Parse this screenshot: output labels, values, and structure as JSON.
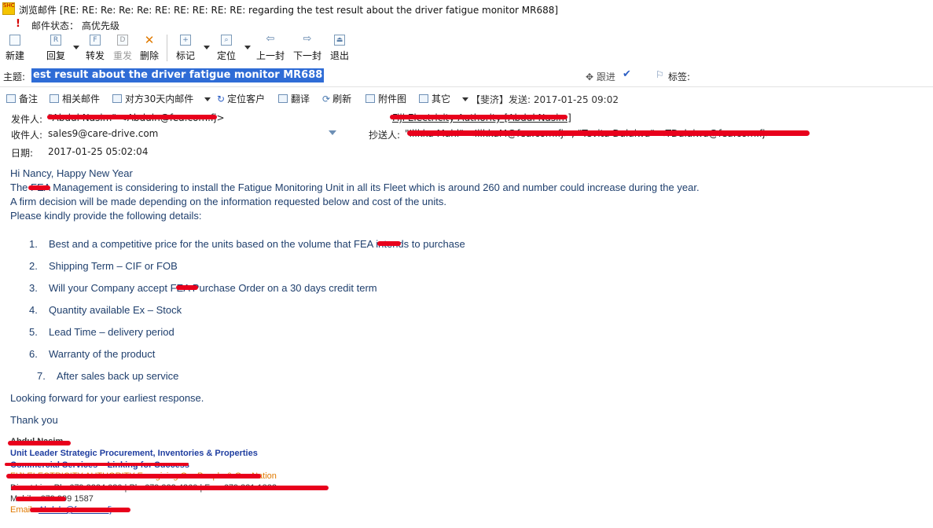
{
  "window": {
    "title": "浏览邮件 [RE: RE: Re: Re: Re: RE: RE: RE: RE: RE: regarding the test result about the driver fatigue monitor MR688]",
    "app_icon_text": "SHOP"
  },
  "mail_status": {
    "label": "邮件状态：",
    "value": "高优先级"
  },
  "toolbar": {
    "new_label": "新建",
    "reply_label": "回复",
    "forward_label": "转发",
    "resend_label": "重发",
    "delete_label": "删除",
    "mark_label": "标记",
    "locate_label": "定位",
    "prev_label": "上一封",
    "next_label": "下一封",
    "exit_label": "退出"
  },
  "subject": {
    "label": "主题:",
    "value": "est result about the driver fatigue monitor MR688",
    "follow_label": "跟进",
    "tag_label": "标签:"
  },
  "actions": {
    "note": "备注",
    "related_mail": "相关邮件",
    "counterpart_30days": "对方30天内邮件",
    "locate_customer": "定位客户",
    "translate": "翻译",
    "refresh": "刷新",
    "attachment_view": "附件图",
    "other": "其它",
    "meta": "【斐济】发送: 2017-01-25 09:02"
  },
  "headers": {
    "from_label": "发件人:",
    "from_value": "\"Abdul Nasim\" <Abduln@fea.com.fj>",
    "to_label": "收件人:",
    "to_value": "sales9@care-drive.com",
    "cc_label": "抄送人:",
    "cc_value": "\"Ilikka Mahl\" <IlikkaM@fea.com.fj>; \"Tevita Dalaiwa\" <TDalaiwa@fea.com.fj>",
    "date_label": "日期:",
    "date_value": "2017-01-25 05:02:04",
    "org_value": "Fiji Electricity Authority [Abdul Nasim]"
  },
  "body": {
    "greeting": "Hi Nancy, Happy New Year",
    "line1_pre": "The ",
    "line1_redacted": "FEA",
    "line1_post": " Management is considering to install the Fatigue Monitoring Unit in all its Fleet which is around 260 and number could increase during the year.",
    "line2": "A firm decision will be made depending on the information requested below and cost of the units.",
    "line3": "Please kindly  provide the following details:",
    "items": [
      {
        "num": "1.",
        "text": "Best and a  competitive price for the units based on the volume that FEA intends to purchase"
      },
      {
        "num": "2.",
        "text": "Shipping Term – CIF or FOB"
      },
      {
        "num": "3.",
        "text": "Will your Company accept FEA Purchase Order on a 30 days credit term"
      },
      {
        "num": "4.",
        "text": "Quantity available Ex – Stock"
      },
      {
        "num": "5.",
        "text": "Lead Time – delivery period"
      },
      {
        "num": "6.",
        "text": "Warranty of the product"
      },
      {
        "num": "7.",
        "text": "After sales back up service"
      }
    ],
    "closing": "Looking forward for your earliest response.",
    "thanks": "Thank you"
  },
  "signature": {
    "name": "Abdul Nasim",
    "title": "Unit Leader Strategic Procurement, Inventories & Properties",
    "dept": "Commercial Services – Linking for Success",
    "org": "FIJI ELECTRICITY AUTHORITY Energising Our People & Our Nation",
    "phone": "Direct Line Ph: 679 3224 080 | Ph: 679 322 4360 | Fax: 679 331 1882",
    "mobile": "Mobile: 679 999 1587",
    "email_label": "Email: ",
    "email_value": "Abduln@fea.com.fj"
  }
}
